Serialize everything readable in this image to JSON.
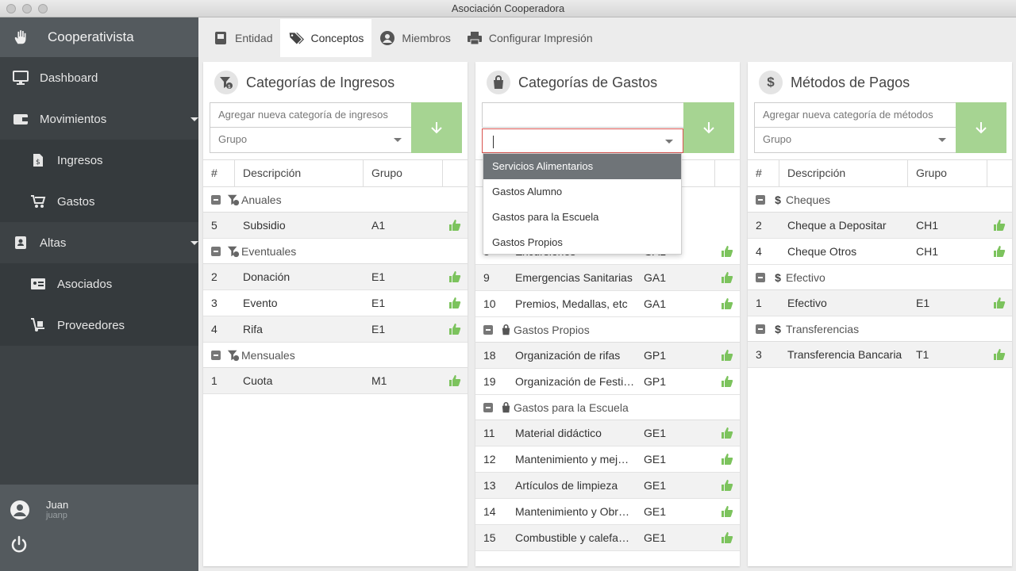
{
  "window": {
    "title": "Asociación Cooperadora"
  },
  "sidebar": {
    "brand": "Cooperativista",
    "items": [
      {
        "label": "Dashboard",
        "icon": "monitor-icon",
        "type": "item"
      },
      {
        "label": "Movimientos",
        "icon": "wallet-icon",
        "type": "group"
      },
      {
        "label": "Ingresos",
        "icon": "receipt-icon",
        "type": "sub"
      },
      {
        "label": "Gastos",
        "icon": "cart-icon",
        "type": "sub"
      },
      {
        "label": "Altas",
        "icon": "address-book-icon",
        "type": "group"
      },
      {
        "label": "Asociados",
        "icon": "id-card-icon",
        "type": "sub"
      },
      {
        "label": "Proveedores",
        "icon": "dolly-icon",
        "type": "sub"
      }
    ],
    "user": {
      "name": "Juan",
      "login": "juanp"
    }
  },
  "tabs": [
    {
      "label": "Entidad",
      "icon": "book-icon",
      "active": false
    },
    {
      "label": "Conceptos",
      "icon": "tags-icon",
      "active": true
    },
    {
      "label": "Miembros",
      "icon": "user-circle-icon",
      "active": false
    },
    {
      "label": "Configurar Impresión",
      "icon": "printer-icon",
      "active": false
    }
  ],
  "colors": {
    "accent_green": "#a6d492",
    "thumb_green": "#7cc35d",
    "sidebar_bg": "#3d4245",
    "dropdown_selected": "#6f7478"
  },
  "columns": {
    "num": "#",
    "desc": "Descripción",
    "group": "Grupo"
  },
  "ingresos": {
    "title": "Categorías de Ingresos",
    "input_placeholder": "Agregar nueva categoría de ingresos",
    "select_placeholder": "Grupo",
    "groups": [
      {
        "name": "Anuales",
        "rows": [
          {
            "n": "5",
            "desc": "Subsidio",
            "grp": "A1"
          }
        ]
      },
      {
        "name": "Eventuales",
        "rows": [
          {
            "n": "2",
            "desc": "Donación",
            "grp": "E1"
          },
          {
            "n": "3",
            "desc": "Evento",
            "grp": "E1"
          },
          {
            "n": "4",
            "desc": "Rifa",
            "grp": "E1"
          }
        ]
      },
      {
        "name": "Mensuales",
        "rows": [
          {
            "n": "1",
            "desc": "Cuota",
            "grp": "M1"
          }
        ]
      }
    ]
  },
  "gastos": {
    "title": "Categorías de Gastos",
    "input_value": "",
    "select_value": "",
    "dropdown_options": [
      "Servicios Alimentarios",
      "Gastos Alumno",
      "Gastos para la Escuela",
      "Gastos Propios"
    ],
    "dropdown_selected": 0,
    "visible_rows": [
      {
        "n": "8",
        "desc": "Excursiones",
        "grp": "GA1"
      },
      {
        "n": "9",
        "desc": "Emergencias Sanitarias",
        "grp": "GA1"
      },
      {
        "n": "10",
        "desc": "Premios, Medallas, etc",
        "grp": "GA1"
      }
    ],
    "groups": [
      {
        "name": "Gastos Propios",
        "rows": [
          {
            "n": "18",
            "desc": "Organización de rifas",
            "grp": "GP1"
          },
          {
            "n": "19",
            "desc": "Organización de Festi…",
            "grp": "GP1"
          }
        ]
      },
      {
        "name": "Gastos para la Escuela",
        "rows": [
          {
            "n": "11",
            "desc": "Material didáctico",
            "grp": "GE1"
          },
          {
            "n": "12",
            "desc": "Mantenimiento y mej…",
            "grp": "GE1"
          },
          {
            "n": "13",
            "desc": "Artículos de limpieza",
            "grp": "GE1"
          },
          {
            "n": "14",
            "desc": "Mantenimiento y Obr…",
            "grp": "GE1"
          },
          {
            "n": "15",
            "desc": "Combustible y calefa…",
            "grp": "GE1"
          }
        ]
      }
    ]
  },
  "metodos": {
    "title": "Métodos de Pagos",
    "input_placeholder": "Agregar nueva categoría de métodos",
    "select_placeholder": "Grupo",
    "groups": [
      {
        "name": "Cheques",
        "rows": [
          {
            "n": "2",
            "desc": "Cheque a Depositar",
            "grp": "CH1"
          },
          {
            "n": "4",
            "desc": "Cheque Otros",
            "grp": "CH1"
          }
        ]
      },
      {
        "name": "Efectivo",
        "rows": [
          {
            "n": "1",
            "desc": "Efectivo",
            "grp": "E1"
          }
        ]
      },
      {
        "name": "Transferencias",
        "rows": [
          {
            "n": "3",
            "desc": "Transferencia Bancaria",
            "grp": "T1"
          }
        ]
      }
    ]
  }
}
